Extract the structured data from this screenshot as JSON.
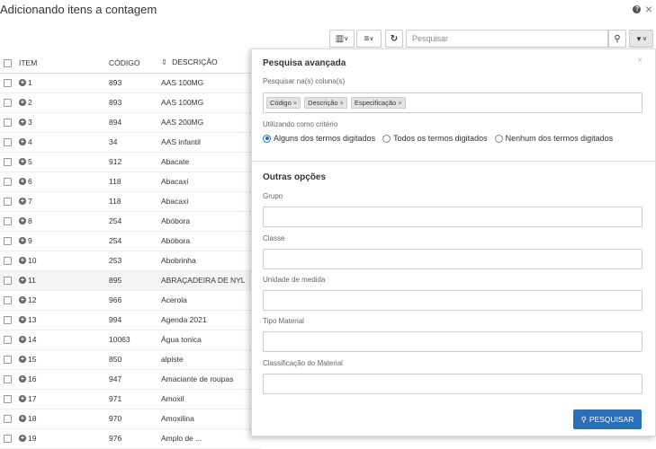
{
  "page": {
    "title": "Adicionando itens a contagem",
    "help_icon": "?",
    "close_icon": "×"
  },
  "toolbar": {
    "columns_icon": "▥",
    "columns_caret": "∨",
    "list_icon": "≡",
    "list_caret": "∨",
    "refresh_icon": "↻",
    "search_placeholder": "Pesquisar",
    "search_icon": "⚲",
    "filter_icon": "▼",
    "filter_caret": "∨"
  },
  "table": {
    "columns": [
      "ITEM",
      "CÓDIGO",
      "DESCRIÇÃO"
    ],
    "sort_icon": "⇕",
    "rows": [
      {
        "item": "1",
        "codigo": "893",
        "descricao": "AAS 100MG"
      },
      {
        "item": "2",
        "codigo": "893",
        "descricao": "AAS 100MG"
      },
      {
        "item": "3",
        "codigo": "894",
        "descricao": "AAS 200MG"
      },
      {
        "item": "4",
        "codigo": "34",
        "descricao": "AAS infantil"
      },
      {
        "item": "5",
        "codigo": "912",
        "descricao": "Abacate"
      },
      {
        "item": "6",
        "codigo": "118",
        "descricao": "Abacaxi"
      },
      {
        "item": "7",
        "codigo": "118",
        "descricao": "Abacaxi"
      },
      {
        "item": "8",
        "codigo": "254",
        "descricao": "Abóbora"
      },
      {
        "item": "9",
        "codigo": "254",
        "descricao": "Abóbora"
      },
      {
        "item": "10",
        "codigo": "253",
        "descricao": "Abobrinha"
      },
      {
        "item": "11",
        "codigo": "895",
        "descricao": "ABRAÇADEIRA DE NYL"
      },
      {
        "item": "12",
        "codigo": "966",
        "descricao": "Acerola"
      },
      {
        "item": "13",
        "codigo": "994",
        "descricao": "Agenda 2021"
      },
      {
        "item": "14",
        "codigo": "10063",
        "descricao": "Água tonica"
      },
      {
        "item": "15",
        "codigo": "850",
        "descricao": "alpiste"
      },
      {
        "item": "16",
        "codigo": "947",
        "descricao": "Amaciante de roupas"
      },
      {
        "item": "17",
        "codigo": "971",
        "descricao": "Amoxil"
      },
      {
        "item": "18",
        "codigo": "970",
        "descricao": "Amoxilina"
      },
      {
        "item": "19",
        "codigo": "976",
        "descricao": "Amplo de ..."
      }
    ]
  },
  "panel": {
    "title": "Pesquisa avançada",
    "close": "×",
    "columns_label": "Pesquisar na(s) coluna(s)",
    "tags": [
      "Código",
      "Descrição",
      "Especificação"
    ],
    "tag_remove": "×",
    "criteria_label": "Utilizando como critério",
    "criteria_options": [
      "Alguns dos termos digitados",
      "Todos os termos digitados",
      "Nenhum dos termos digitados"
    ],
    "criteria_selected": 0,
    "other_title": "Outras opções",
    "fields": [
      "Grupo",
      "Classe",
      "Unidade de medida",
      "Tipo Material",
      "Classificação do Material"
    ],
    "search_button": "PESQUISAR",
    "search_button_icon": "⚲"
  }
}
